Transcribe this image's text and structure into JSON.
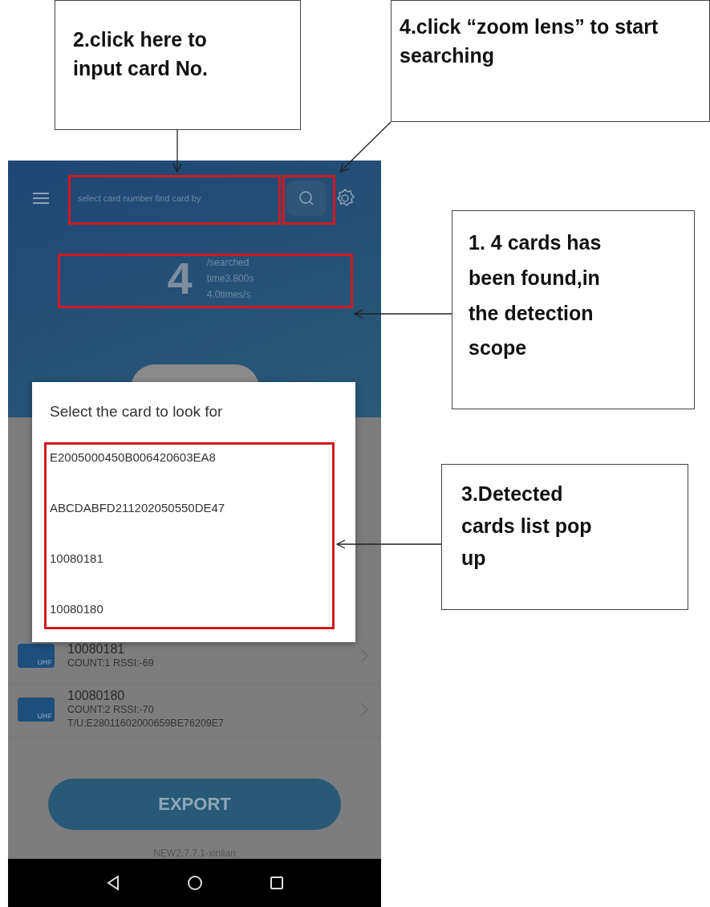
{
  "callouts": [
    {
      "text": "2.click here to input card No."
    },
    {
      "text": "4.click “zoom lens” to start searching"
    },
    {
      "text": "1. 4 cards has been found,in the detection scope"
    },
    {
      "text": "3.Detected cards list pop up"
    }
  ],
  "app": {
    "search": {
      "placeholder": "select card number find card by"
    },
    "stats": {
      "count": "4",
      "lines": [
        "/searched",
        "time3.800s",
        "4.0times/s"
      ]
    },
    "rows": [
      {
        "icon_label": "UHF",
        "title": "10080181",
        "lines": [
          "COUNT:1  RSSI:-69"
        ]
      },
      {
        "icon_label": "UHF",
        "title": "10080180",
        "lines": [
          "COUNT:2  RSSI:-70",
          "T/U:E28011602000659BE76209E7"
        ]
      }
    ],
    "export_button": "EXPORT",
    "version": "NEW2.7.7.1-xinlian"
  },
  "dialog": {
    "title": "Select the card to look for",
    "options": [
      "E2005000450B006420603EA8",
      "ABCDABFD211202050550DE47",
      "10080181",
      "10080180"
    ]
  }
}
